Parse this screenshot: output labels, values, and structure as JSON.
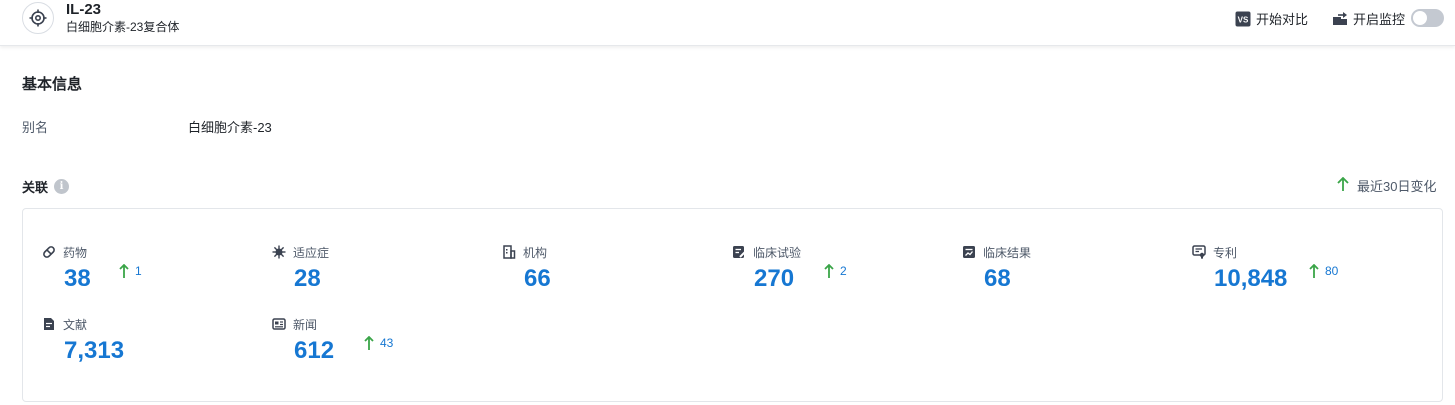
{
  "header": {
    "title": "IL-23",
    "subtitle": "白细胞介素-23复合体",
    "compare_label": "开始对比",
    "monitor_label": "开启监控",
    "monitor_on": false
  },
  "basic_info": {
    "title": "基本信息",
    "alias_label": "别名",
    "alias_value": "白细胞介素-23"
  },
  "relations": {
    "title": "关联",
    "change_legend": "最近30日变化",
    "stats": [
      {
        "label": "药物",
        "value": "38",
        "delta": "1",
        "icon": "pill-icon"
      },
      {
        "label": "适应症",
        "value": "28",
        "delta": "",
        "icon": "virus-icon"
      },
      {
        "label": "机构",
        "value": "66",
        "delta": "",
        "icon": "building-icon"
      },
      {
        "label": "临床试验",
        "value": "270",
        "delta": "2",
        "icon": "clinical-trial-icon"
      },
      {
        "label": "临床结果",
        "value": "68",
        "delta": "",
        "icon": "clinical-result-icon"
      },
      {
        "label": "专利",
        "value": "10,848",
        "delta": "80",
        "icon": "patent-icon"
      },
      {
        "label": "文献",
        "value": "7,313",
        "delta": "",
        "icon": "document-icon"
      },
      {
        "label": "新闻",
        "value": "612",
        "delta": "43",
        "icon": "news-icon"
      }
    ]
  },
  "colors": {
    "accent": "#1677d2",
    "up_arrow": "#3aa548"
  }
}
